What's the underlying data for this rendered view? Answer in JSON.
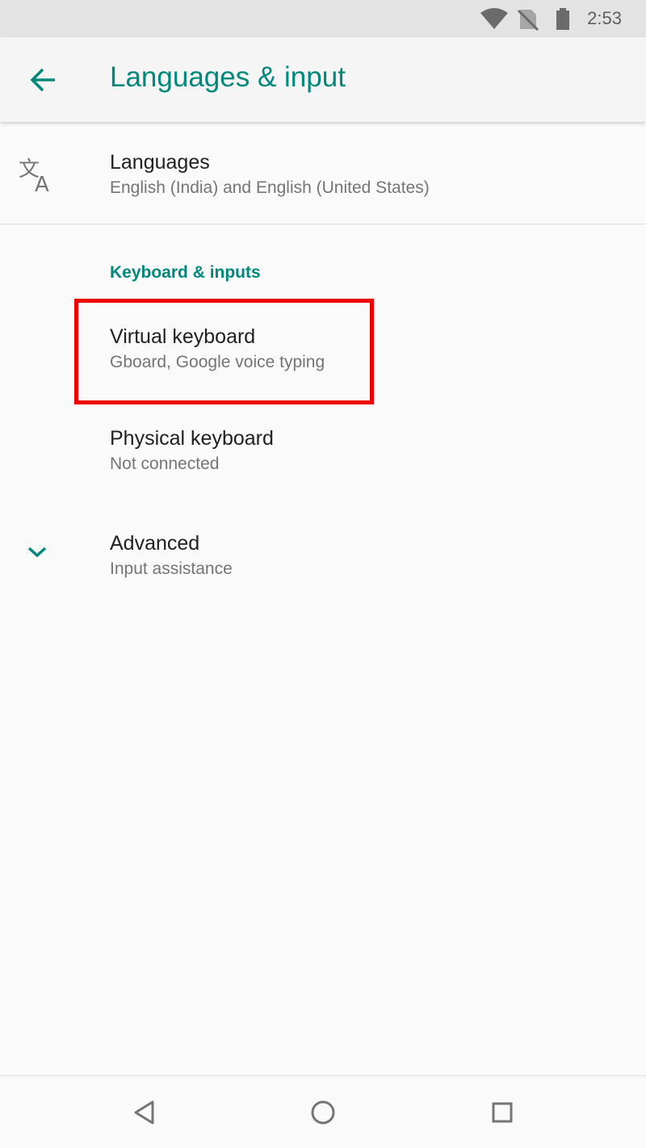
{
  "status_bar": {
    "time": "2:53",
    "icons": [
      "wifi-icon",
      "no-sim-icon",
      "battery-icon"
    ]
  },
  "toolbar": {
    "title": "Languages & input",
    "back_icon": "arrow-back-icon"
  },
  "languages": {
    "title": "Languages",
    "summary": "English (India) and English (United States)",
    "icon": "translate-icon"
  },
  "keyboard_section": {
    "header": "Keyboard & inputs",
    "items": [
      {
        "title": "Virtual keyboard",
        "summary": "Gboard, Google voice typing"
      },
      {
        "title": "Physical keyboard",
        "summary": "Not connected"
      }
    ]
  },
  "advanced": {
    "title": "Advanced",
    "summary": "Input assistance",
    "icon": "chevron-down-icon"
  },
  "nav_bar": {
    "buttons": [
      "back-nav-icon",
      "home-nav-icon",
      "recents-nav-icon"
    ]
  },
  "colors": {
    "accent": "#00897b",
    "highlight": "#ee0000",
    "status_bar_bg": "#e3e3e3",
    "background": "#fafafa"
  }
}
